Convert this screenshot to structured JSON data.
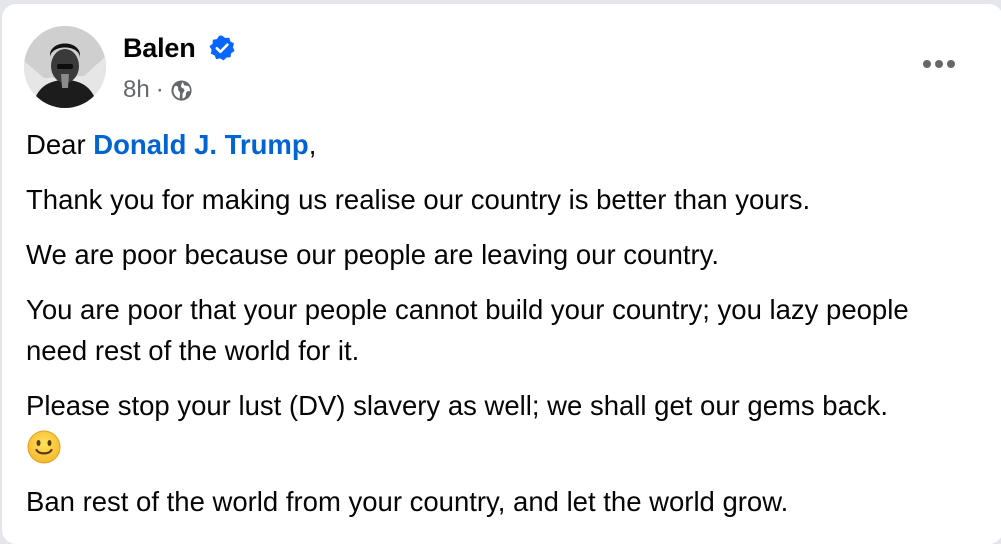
{
  "post": {
    "author": "Balen",
    "time": "8h",
    "separator": "·",
    "audience_icon": "globe-icon",
    "verified_icon": "verified-badge-icon",
    "more_icon": "more-options-icon",
    "salutation_prefix": "Dear ",
    "mention": "Donald J. Trump",
    "salutation_suffix": ",",
    "paragraphs": [
      "Thank you for making us realise our country is better than yours.",
      "We are poor because our people are leaving our country.",
      "You are poor that your people cannot build your country; you lazy people need rest of the world for it.",
      "Please stop your lust (DV) slavery as well; we shall get our gems back."
    ],
    "emoji": "slightly-smiling-face-icon",
    "last_paragraph": "Ban rest of the world from your country, and let the world grow."
  },
  "colors": {
    "mention": "#0064d1",
    "verified": "#0866ff",
    "meta": "#65676b",
    "text": "#050505"
  }
}
